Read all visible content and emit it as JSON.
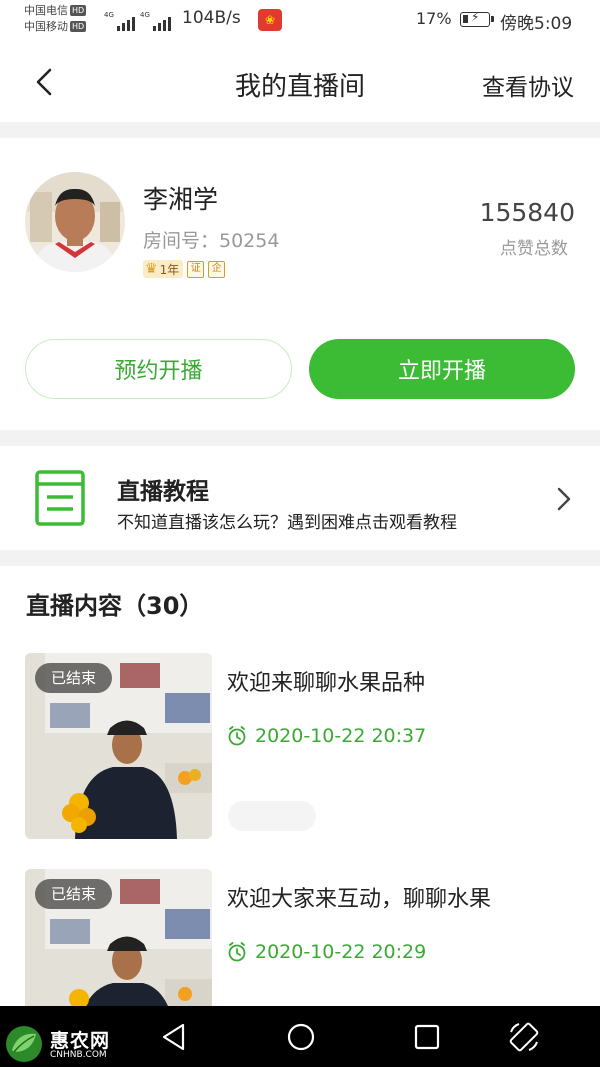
{
  "status_bar": {
    "carrier_1": "中国电信",
    "carrier_2": "中国移动",
    "hd_label": "HD",
    "network": "4G",
    "net_speed": "104B/s",
    "battery_pct": "17%",
    "time": "傍晚5:09"
  },
  "nav": {
    "title": "我的直播间",
    "right_link": "查看协议",
    "back_icon": "chevron-left-icon"
  },
  "profile": {
    "name": "李湘学",
    "room_label": "房间号：50254",
    "badge_level": "1年",
    "badge_icon_1": "证",
    "badge_icon_2": "企",
    "likes_count": "155840",
    "likes_label": "点赞总数",
    "btn_schedule": "预约开播",
    "btn_start": "立即开播"
  },
  "tutorial": {
    "title": "直播教程",
    "subtitle": "不知道直播该怎么玩？遇到困难点击观看教程",
    "icon": "document-icon"
  },
  "content": {
    "section_title": "直播内容（30）",
    "items": [
      {
        "status": "已结束",
        "title": "欢迎来聊聊水果品种",
        "time": "2020-10-22 20:37"
      },
      {
        "status": "已结束",
        "title": "欢迎大家来互动，聊聊水果",
        "time": "2020-10-22 20:29"
      }
    ]
  },
  "watermark": {
    "name": "惠农网",
    "domain": "CNHNB.COM"
  },
  "colors": {
    "brand_green": "#3bbc34",
    "text_green": "#3aaa34"
  }
}
